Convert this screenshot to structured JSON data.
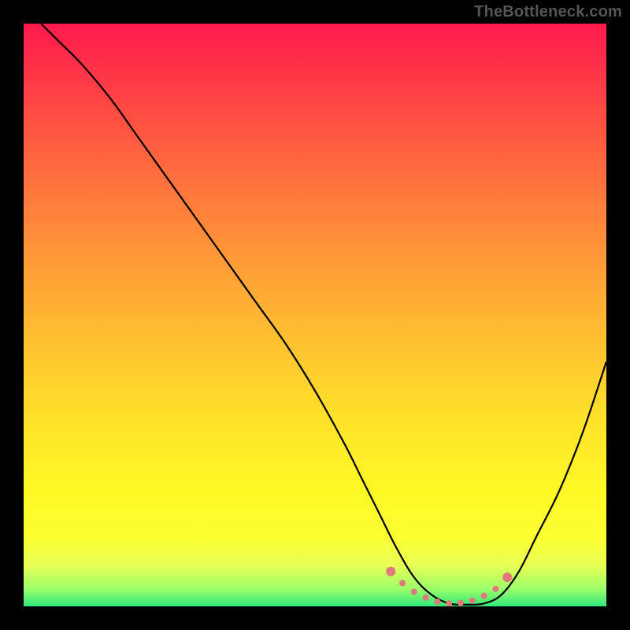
{
  "watermark": "TheBottleneck.com",
  "colors": {
    "frame": "#000000",
    "watermark_text": "#555555",
    "gradient_top": "#ff1a4d",
    "gradient_bottom": "#30e879",
    "curve": "#000000",
    "markers": "#e07a7a"
  },
  "chart_data": {
    "type": "line",
    "title": "",
    "xlabel": "",
    "ylabel": "",
    "xlim": [
      0,
      100
    ],
    "ylim": [
      0,
      100
    ],
    "grid": false,
    "legend": false,
    "series": [
      {
        "name": "bottleneck-curve",
        "x": [
          3,
          6,
          10,
          15,
          20,
          25,
          30,
          35,
          40,
          45,
          50,
          55,
          58,
          61,
          64,
          67,
          70,
          73,
          76,
          79,
          82,
          85,
          88,
          92,
          96,
          100
        ],
        "y": [
          100,
          97,
          93,
          87,
          80,
          73,
          66,
          59,
          52,
          45,
          37,
          28,
          22,
          16,
          10,
          5,
          2,
          0.5,
          0.3,
          0.5,
          2,
          6,
          12,
          20,
          30,
          42
        ]
      }
    ],
    "markers": {
      "name": "trough-markers",
      "x": [
        63,
        65,
        67,
        69,
        71,
        73,
        75,
        77,
        79,
        81,
        83
      ],
      "y": [
        6,
        4,
        2.5,
        1.5,
        0.8,
        0.5,
        0.6,
        1,
        1.8,
        3,
        5
      ]
    }
  }
}
